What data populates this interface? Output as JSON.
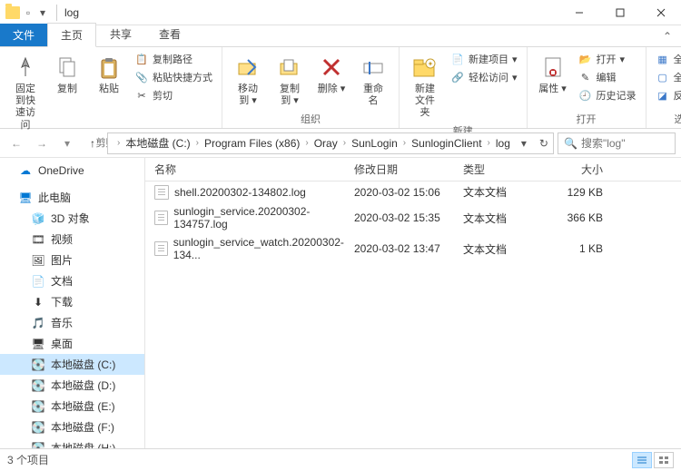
{
  "window": {
    "title": "log"
  },
  "tabs": {
    "file": "文件",
    "home": "主页",
    "share": "共享",
    "view": "查看"
  },
  "ribbon": {
    "clipboard": {
      "label": "剪贴板",
      "pin": "固定到快\n速访问",
      "copy": "复制",
      "paste": "粘贴",
      "copy_path": "复制路径",
      "paste_shortcut": "粘贴快捷方式",
      "cut": "剪切"
    },
    "organize": {
      "label": "组织",
      "move_to": "移动到",
      "copy_to": "复制到",
      "delete": "删除",
      "rename": "重命名"
    },
    "new": {
      "label": "新建",
      "new_folder": "新建\n文件夹",
      "new_item": "新建项目",
      "easy_access": "轻松访问"
    },
    "open": {
      "label": "打开",
      "properties": "属性",
      "open": "打开",
      "edit": "编辑",
      "history": "历史记录"
    },
    "select": {
      "label": "选择",
      "select_all": "全部选择",
      "select_none": "全部取消",
      "invert": "反向选择"
    }
  },
  "breadcrumb": [
    "本地磁盘 (C:)",
    "Program Files (x86)",
    "Oray",
    "SunLogin",
    "SunloginClient",
    "log"
  ],
  "search_placeholder": "搜索\"log\"",
  "columns": {
    "name": "名称",
    "date": "修改日期",
    "type": "类型",
    "size": "大小"
  },
  "files": [
    {
      "name": "shell.20200302-134802.log",
      "date": "2020-03-02 15:06",
      "type": "文本文档",
      "size": "129 KB"
    },
    {
      "name": "sunlogin_service.20200302-134757.log",
      "date": "2020-03-02 15:35",
      "type": "文本文档",
      "size": "366 KB"
    },
    {
      "name": "sunlogin_service_watch.20200302-134...",
      "date": "2020-03-02 13:47",
      "type": "文本文档",
      "size": "1 KB"
    }
  ],
  "sidebar": {
    "onedrive": "OneDrive",
    "this_pc": "此电脑",
    "items": [
      {
        "label": "3D 对象"
      },
      {
        "label": "视频"
      },
      {
        "label": "图片"
      },
      {
        "label": "文档"
      },
      {
        "label": "下载"
      },
      {
        "label": "音乐"
      },
      {
        "label": "桌面"
      },
      {
        "label": "本地磁盘 (C:)",
        "selected": true
      },
      {
        "label": "本地磁盘 (D:)"
      },
      {
        "label": "本地磁盘 (E:)"
      },
      {
        "label": "本地磁盘 (F:)"
      },
      {
        "label": "本地磁盘 (H:)"
      }
    ]
  },
  "status": "3 个项目"
}
